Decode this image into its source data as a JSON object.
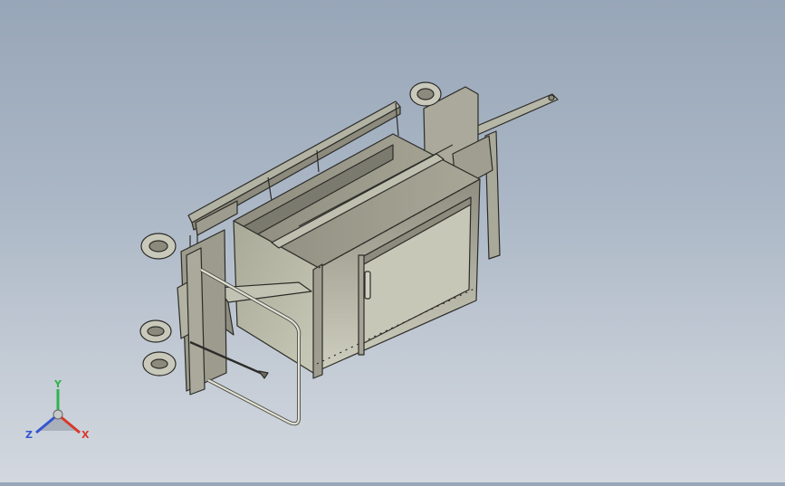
{
  "viewport": {
    "background_top": "#97a6b8",
    "background_bottom": "#d3d8df",
    "model_color": "#b9b9aa",
    "edge_color": "#2c2c28"
  },
  "triad": {
    "x_label": "X",
    "y_label": "Y",
    "z_label": "Z",
    "x_color": "#d8392b",
    "y_color": "#2fb44a",
    "z_color": "#3455d1"
  }
}
